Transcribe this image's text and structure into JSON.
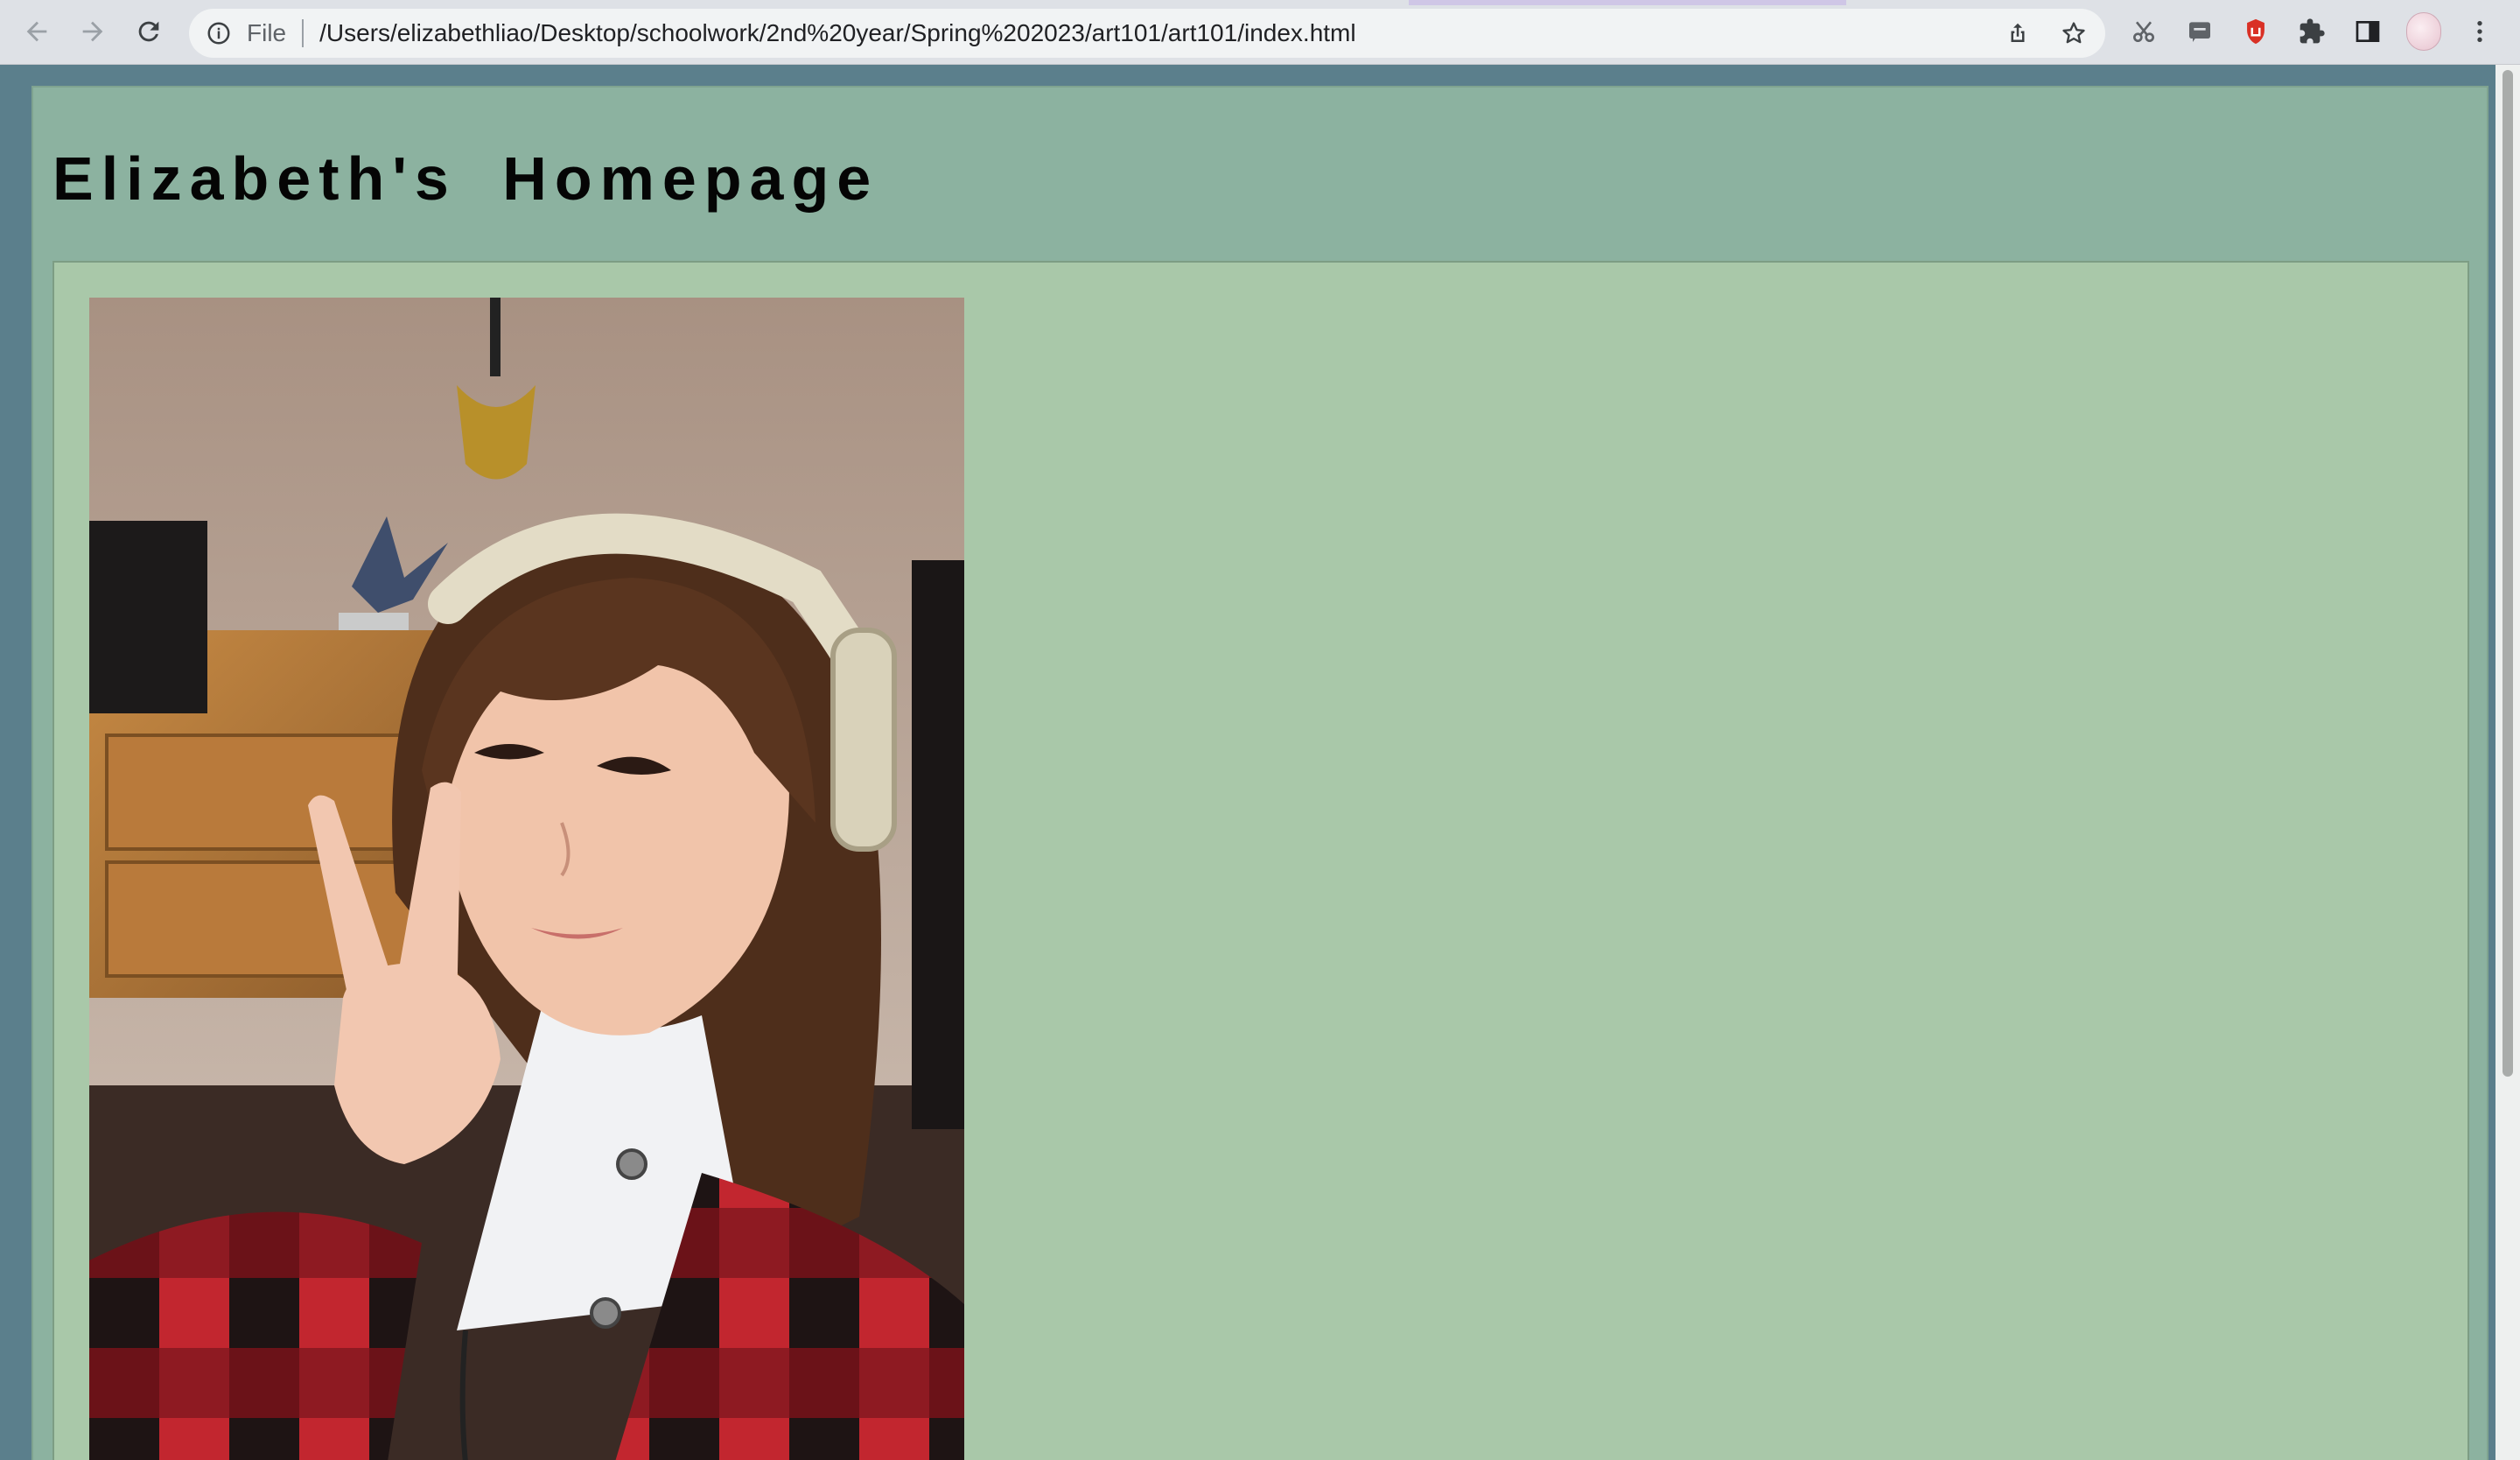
{
  "browser": {
    "scheme_label": "File",
    "url": "/Users/elizabethliao/Desktop/schoolwork/2nd%20year/Spring%202023/art101/art101/index.html",
    "nav_icons": [
      "back-arrow-icon",
      "forward-arrow-icon",
      "reload-icon"
    ],
    "omnibox_icons": [
      "info-icon",
      "share-icon",
      "star-icon"
    ],
    "extension_icons": [
      "scissors-icon",
      "chat-icon",
      "stop-hand-icon",
      "puzzle-icon",
      "side-panel-icon",
      "menu-icon"
    ],
    "colors": {
      "toolbar": "#dee1e6",
      "omnibox": "#f1f3f4"
    }
  },
  "page": {
    "title": "Elizabeth's Homepage",
    "photo_alt": "Selfie of a girl with headphones making a peace sign",
    "colors": {
      "outer_background": "#5b7f8c",
      "header_background": "#8cb2a0",
      "content_background": "#a9c8a9"
    }
  }
}
